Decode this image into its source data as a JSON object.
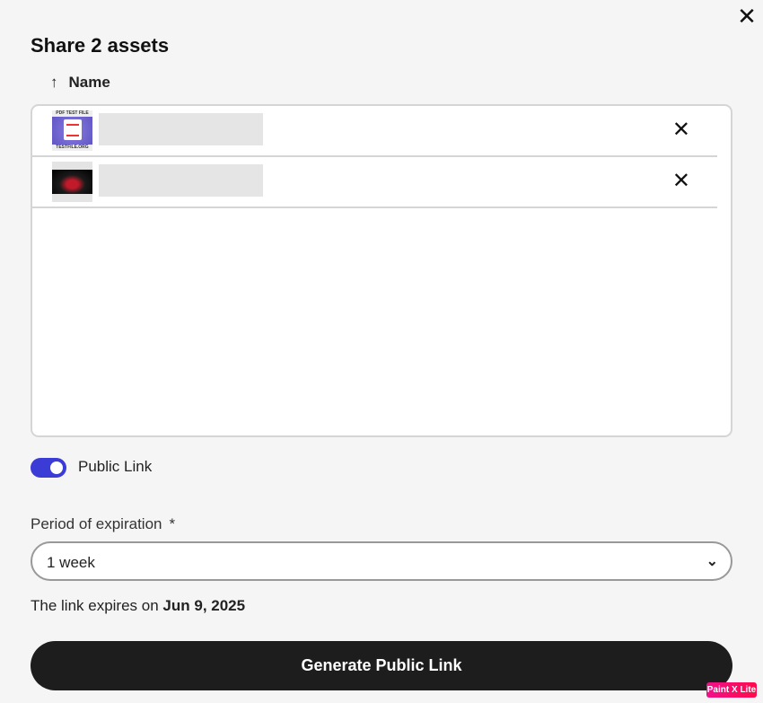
{
  "dialog": {
    "title": "Share 2 assets",
    "close_icon": "close-icon"
  },
  "list": {
    "sort_column": "Name",
    "sort_icon": "arrow-up-icon",
    "items": [
      {
        "thumbnail": "pdf-test-file-thumbnail",
        "thumbnail_text": [
          "PDF TEST FILE",
          "TESTFILE.ORG"
        ]
      },
      {
        "thumbnail": "red-car-thumbnail"
      }
    ]
  },
  "public_link": {
    "label": "Public Link",
    "enabled": true,
    "accent": "#3b3bd6"
  },
  "expiration": {
    "label": "Period of expiration",
    "required_marker": "*",
    "value": "1 week"
  },
  "expires_text": {
    "prefix": "The link expires on",
    "date": "Jun 9, 2025"
  },
  "generate_button": "Generate Public Link",
  "watermark": "Paint X Lite"
}
